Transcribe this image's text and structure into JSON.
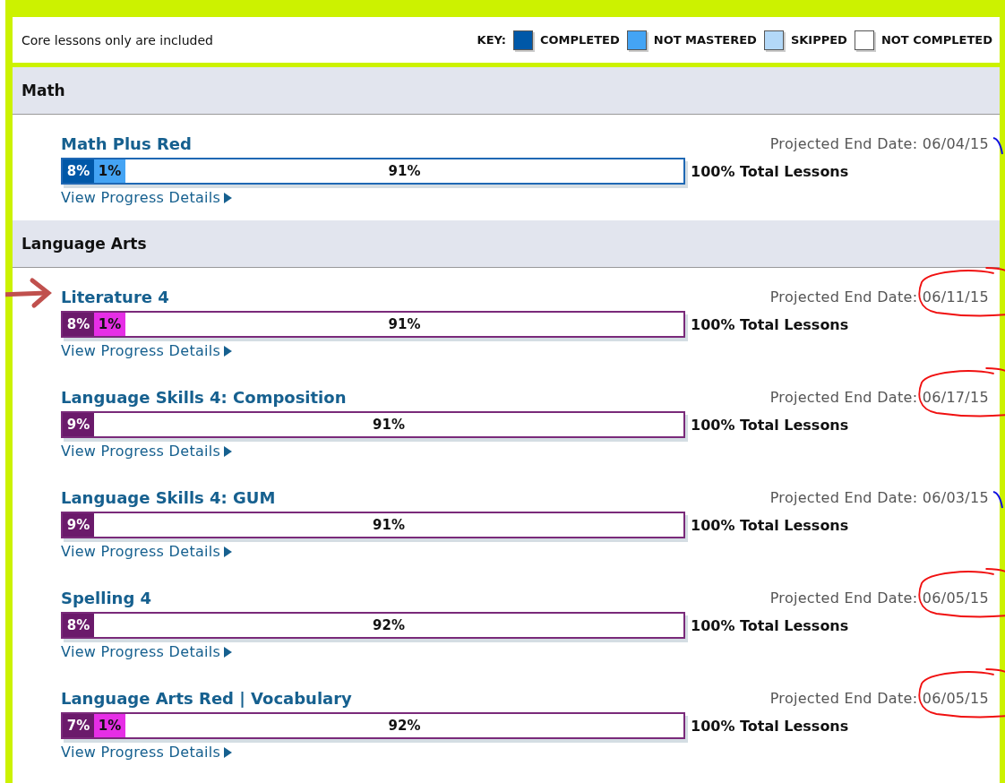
{
  "notice": "Core lessons only are included",
  "key": {
    "label": "KEY:",
    "items": [
      {
        "label": "COMPLETED",
        "color": "#0058a8"
      },
      {
        "label": "NOT MASTERED",
        "color": "#44a4f4"
      },
      {
        "label": "SKIPPED",
        "color": "#b3d8f8"
      },
      {
        "label": "NOT COMPLETED",
        "color": "#ffffff"
      }
    ]
  },
  "sections": [
    {
      "title": "Math",
      "courses": [
        {
          "title": "Math Plus Red",
          "color": "#1f68b4",
          "end_label": "Projected End Date:",
          "end_date": "06/04/15",
          "circled": false,
          "ticked": true,
          "arrow": false,
          "segments": [
            {
              "label": "8%",
              "color": "#0058a8"
            },
            {
              "label": "1%",
              "color": "#44a4f4"
            }
          ],
          "remaining": "91%",
          "total": "100% Total Lessons",
          "link": "View Progress Details"
        }
      ]
    },
    {
      "title": "Language Arts",
      "courses": [
        {
          "title": "Literature 4",
          "color": "#7a2a7a",
          "end_label": "Projected End Date:",
          "end_date": "06/11/15",
          "circled": true,
          "ticked": false,
          "arrow": true,
          "segments": [
            {
              "label": "8%",
              "color": "#6b1a6b"
            },
            {
              "label": "1%",
              "color": "#e62ee6"
            }
          ],
          "remaining": "91%",
          "total": "100% Total Lessons",
          "link": "View Progress Details"
        },
        {
          "title": "Language Skills 4: Composition",
          "color": "#7a2a7a",
          "end_label": "Projected End Date:",
          "end_date": "06/17/15",
          "circled": true,
          "ticked": false,
          "arrow": false,
          "segments": [
            {
              "label": "9%",
              "color": "#6b1a6b"
            }
          ],
          "remaining": "91%",
          "total": "100% Total Lessons",
          "link": "View Progress Details"
        },
        {
          "title": "Language Skills 4: GUM",
          "color": "#7a2a7a",
          "end_label": "Projected End Date:",
          "end_date": "06/03/15",
          "circled": false,
          "ticked": true,
          "arrow": false,
          "segments": [
            {
              "label": "9%",
              "color": "#6b1a6b"
            }
          ],
          "remaining": "91%",
          "total": "100% Total Lessons",
          "link": "View Progress Details"
        },
        {
          "title": "Spelling 4",
          "color": "#7a2a7a",
          "end_label": "Projected End Date:",
          "end_date": "06/05/15",
          "circled": true,
          "ticked": false,
          "arrow": false,
          "segments": [
            {
              "label": "8%",
              "color": "#6b1a6b"
            }
          ],
          "remaining": "92%",
          "total": "100% Total Lessons",
          "link": "View Progress Details"
        },
        {
          "title": "Language Arts Red | Vocabulary",
          "color": "#7a2a7a",
          "end_label": "Projected End Date:",
          "end_date": "06/05/15",
          "circled": true,
          "ticked": false,
          "arrow": false,
          "segments": [
            {
              "label": "7%",
              "color": "#6b1a6b"
            },
            {
              "label": "1%",
              "color": "#e62ee6"
            }
          ],
          "remaining": "92%",
          "total": "100% Total Lessons",
          "link": "View Progress Details"
        }
      ]
    }
  ]
}
